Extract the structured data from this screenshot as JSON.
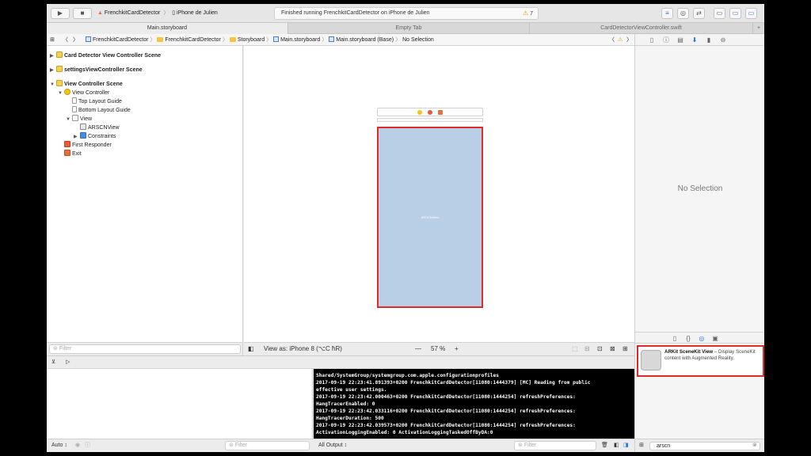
{
  "toolbar": {
    "run_icon": "play-icon",
    "stop_icon": "stop-icon",
    "scheme": "FrenchkitCardDetector",
    "destination": "iPhone de Julien",
    "activity_message": "Finished running FrenchkitCardDetector on iPhone de Julien",
    "warning_count": "7"
  },
  "tabs": [
    {
      "label": "Main.storyboard",
      "active": true
    },
    {
      "label": "Empty Tab",
      "active": false
    },
    {
      "label": "CardDetectorViewController.swift",
      "active": false
    }
  ],
  "jumpbar": {
    "crumbs": [
      "FrenchkitCardDetector",
      "FrenchkitCardDetector",
      "Storyboard",
      "Main.storyboard",
      "Main.storyboard (Base)",
      "No Selection"
    ]
  },
  "outline": {
    "rows": [
      {
        "label": "Card Detector View Controller Scene",
        "indent": 0,
        "tri": "▶",
        "icon": "scene",
        "scene": true
      },
      {
        "label": "settingsViewController Scene",
        "indent": 0,
        "tri": "▶",
        "icon": "scene",
        "scene": true
      },
      {
        "label": "View Controller Scene",
        "indent": 0,
        "tri": "▼",
        "icon": "scene",
        "scene": true
      },
      {
        "label": "View Controller",
        "indent": 1,
        "tri": "▼",
        "icon": "vc",
        "scene": false
      },
      {
        "label": "Top Layout Guide",
        "indent": 2,
        "tri": "",
        "icon": "guide",
        "scene": false
      },
      {
        "label": "Bottom Layout Guide",
        "indent": 2,
        "tri": "",
        "icon": "guide",
        "scene": false
      },
      {
        "label": "View",
        "indent": 2,
        "tri": "▼",
        "icon": "view",
        "scene": false
      },
      {
        "label": "ARSCNView",
        "indent": 3,
        "tri": "",
        "icon": "ar",
        "scene": false
      },
      {
        "label": "Constraints",
        "indent": 3,
        "tri": "▶",
        "icon": "cons",
        "scene": false
      },
      {
        "label": "First Responder",
        "indent": 1,
        "tri": "",
        "icon": "resp",
        "scene": false
      },
      {
        "label": "Exit",
        "indent": 1,
        "tri": "",
        "icon": "exit",
        "scene": false
      }
    ],
    "filter_placeholder": "Filter"
  },
  "canvas": {
    "view_label": "ARSCNView",
    "view_as": "View as: iPhone 8 (⌥C ħR)",
    "zoom_minus": "—",
    "zoom": "57 %",
    "zoom_plus": "+"
  },
  "debug": {
    "console_lines": [
      "Shared/SystemGroup/systemgroup.com.apple.configurationprofiles",
      "2017-09-19 22:23:41.891393+0200 FrenchkitCardDetector[11080:1444379] [MC] Reading from public",
      "effective user settings.",
      "2017-09-19 22:23:42.000463+0200 FrenchkitCardDetector[11080:1444254] refreshPreferences:",
      "HangTracerEnabled: 0",
      "2017-09-19 22:23:42.033116+0200 FrenchkitCardDetector[11080:1444254] refreshPreferences:",
      "HangTracerDuration: 500",
      "2017-09-19 22:23:42.039573+0200 FrenchkitCardDetector[11080:1444254] refreshPreferences:",
      "ActivationLoggingEnabled: 0 ActivationLoggingTaskedOffByDA:0"
    ],
    "vars_scope": "Auto ↕",
    "vars_filter": "Filter",
    "output_select": "All Output ↕",
    "console_filter": "Filter"
  },
  "inspector": {
    "no_selection": "No Selection",
    "library_item": {
      "title": "ARKit SceneKit View",
      "description": " – Display SceneKit content with Augmented Reality."
    },
    "library_search": "arscn"
  }
}
